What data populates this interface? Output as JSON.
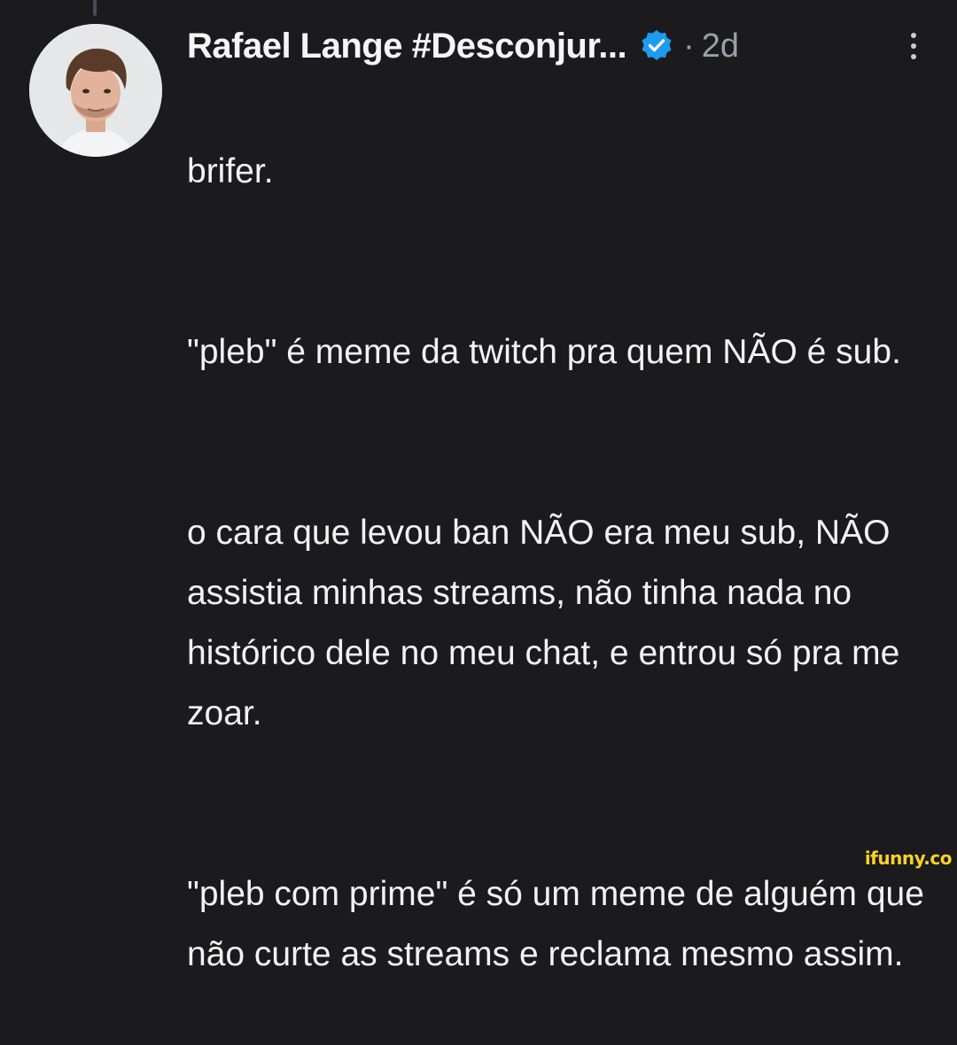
{
  "tweet": {
    "display_name": "Rafael Lange #Desconjur...",
    "verified_icon": "verified-badge-icon",
    "separator": "·",
    "timestamp": "2d",
    "more_icon": "more-vertical-icon",
    "avatar_icon": "user-avatar",
    "paragraphs": [
      "brifer.",
      "\"pleb\" é meme da twitch pra quem NÃO é sub.",
      "o cara que levou ban NÃO era meu sub, NÃO assistia minhas streams, não tinha nada no histórico dele no meu chat, e entrou só pra me zoar.",
      "\"pleb com prime\" é só um meme de alguém que não curte as streams e reclama mesmo assim."
    ]
  },
  "watermark": {
    "text": "ifunny.co"
  },
  "colors": {
    "background": "#1b1b1d",
    "text": "#f2f2f2",
    "muted": "#9aa0a6",
    "verified": "#1d9bf0",
    "watermark": "#f8d22a"
  }
}
